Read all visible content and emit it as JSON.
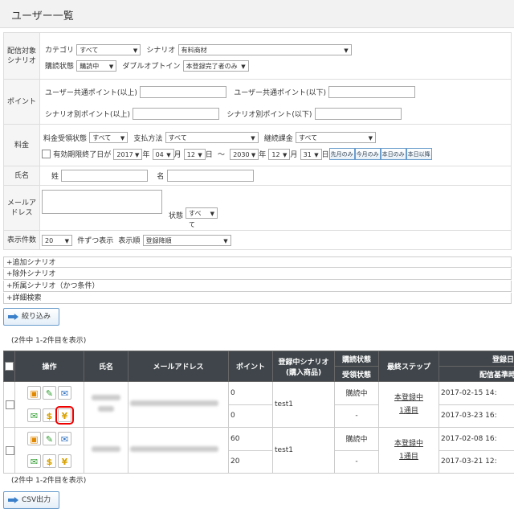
{
  "page": {
    "title": "ユーザー一覧"
  },
  "search": {
    "delivery_label": "配信対象シナリオ",
    "category_label": "カテゴリ",
    "category_value": "すべて",
    "scenario_label": "シナリオ",
    "scenario_value": "有料商材",
    "subscribe_state_label": "購読状態",
    "subscribe_state_value": "購読中",
    "double_optin_label": "ダブルオプトイン",
    "double_optin_value": "本登録完了者のみ",
    "points_label": "ポイント",
    "common_points_min_label": "ユーザー共通ポイント(以上)",
    "common_points_max_label": "ユーザー共通ポイント(以下)",
    "scenario_points_min_label": "シナリオ別ポイント(以上)",
    "scenario_points_max_label": "シナリオ別ポイント(以下)",
    "fee_label": "料金",
    "fee_state_label": "料金受領状態",
    "fee_state_value": "すべて",
    "payment_label": "支払方法",
    "payment_value": "すべて",
    "recurring_label": "継続課金",
    "recurring_value": "すべて",
    "expiry_label": "有効期限終了日が",
    "from_year": "2017",
    "from_month": "04",
    "from_day": "12",
    "to_year": "2030",
    "to_month": "12",
    "to_day": "31",
    "unit_year": "年",
    "unit_month": "月",
    "unit_day": "日",
    "range_sep": "～",
    "btn_last_month": "先月のみ",
    "btn_this_month": "今月のみ",
    "btn_today": "本日のみ",
    "btn_after_today": "本日以降",
    "name_label": "氏名",
    "last_name_label": "姓",
    "first_name_label": "名",
    "email_label": "メールアドレス",
    "email_state_label": "状態",
    "email_state_value": "すべて",
    "display_count_label": "表示件数",
    "display_count_value": "20",
    "per_page_label": "件ずつ表示",
    "sort_label": "表示順",
    "sort_value": "登録降順"
  },
  "expanders": [
    "+追加シナリオ",
    "+除外シナリオ",
    "+所属シナリオ（かつ条件）",
    "+詳細検索"
  ],
  "filter_button": "絞り込み",
  "count_text": "(2件中 1-2件目を表示)",
  "table": {
    "headers": {
      "operation": "操作",
      "name": "氏名",
      "email": "メールアドレス",
      "points": "ポイント",
      "scenario": "登録中シナリオ",
      "scenario_sub": "(購入商品)",
      "subscribe": "購読状態",
      "receive": "受領状態",
      "last_step": "最終ステップ",
      "reg_date": "登録日",
      "base_date": "配信基準時"
    },
    "rows": [
      {
        "point1": "0",
        "point2": "0",
        "scenario": "test1",
        "subscribe": "購読中",
        "receive": "-",
        "step1": "本登録中",
        "step2": "1通目",
        "date1": "2017-02-15 14:",
        "date2": "2017-03-23 16:"
      },
      {
        "point1": "60",
        "point2": "20",
        "scenario": "test1",
        "subscribe": "購読中",
        "receive": "-",
        "step1": "本登録中",
        "step2": "1通目",
        "date1": "2017-02-08 16:",
        "date2": "2017-03-21 12:"
      }
    ]
  },
  "count_text_bottom": "(2件中 1-2件目を表示)",
  "csv_button": "CSV出力"
}
